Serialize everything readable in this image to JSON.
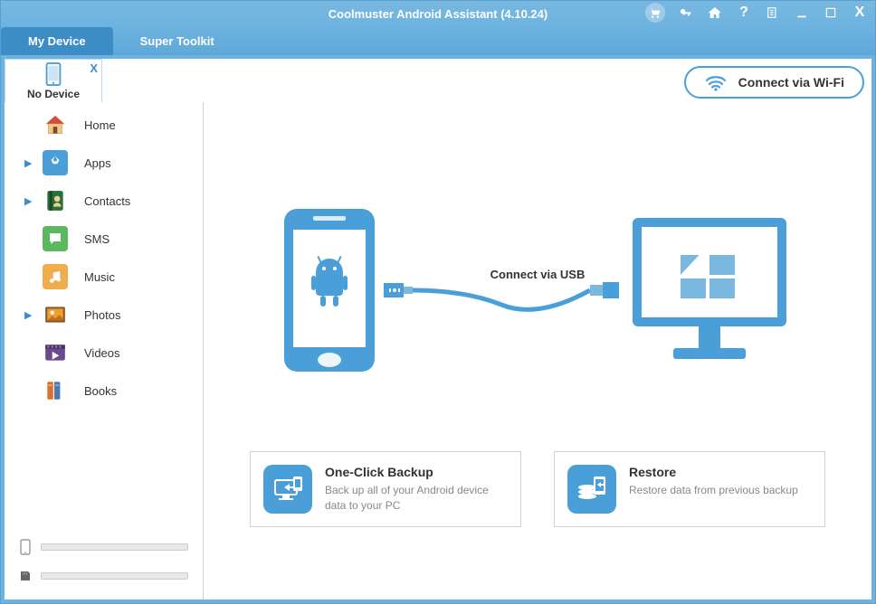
{
  "title": "Coolmuster Android Assistant (4.10.24)",
  "tabs": {
    "my_device": "My Device",
    "super_toolkit": "Super Toolkit"
  },
  "device_tab": {
    "label": "No Device"
  },
  "wifi_button": "Connect via Wi-Fi",
  "sidebar": {
    "items": [
      {
        "label": "Home",
        "expandable": false
      },
      {
        "label": "Apps",
        "expandable": true
      },
      {
        "label": "Contacts",
        "expandable": true
      },
      {
        "label": "SMS",
        "expandable": false
      },
      {
        "label": "Music",
        "expandable": false
      },
      {
        "label": "Photos",
        "expandable": true
      },
      {
        "label": "Videos",
        "expandable": false
      },
      {
        "label": "Books",
        "expandable": false
      }
    ]
  },
  "diagram": {
    "usb_label": "Connect via USB"
  },
  "cards": {
    "backup": {
      "title": "One-Click Backup",
      "desc": "Back up all of your Android device data to your PC"
    },
    "restore": {
      "title": "Restore",
      "desc": "Restore data from previous backup"
    }
  }
}
